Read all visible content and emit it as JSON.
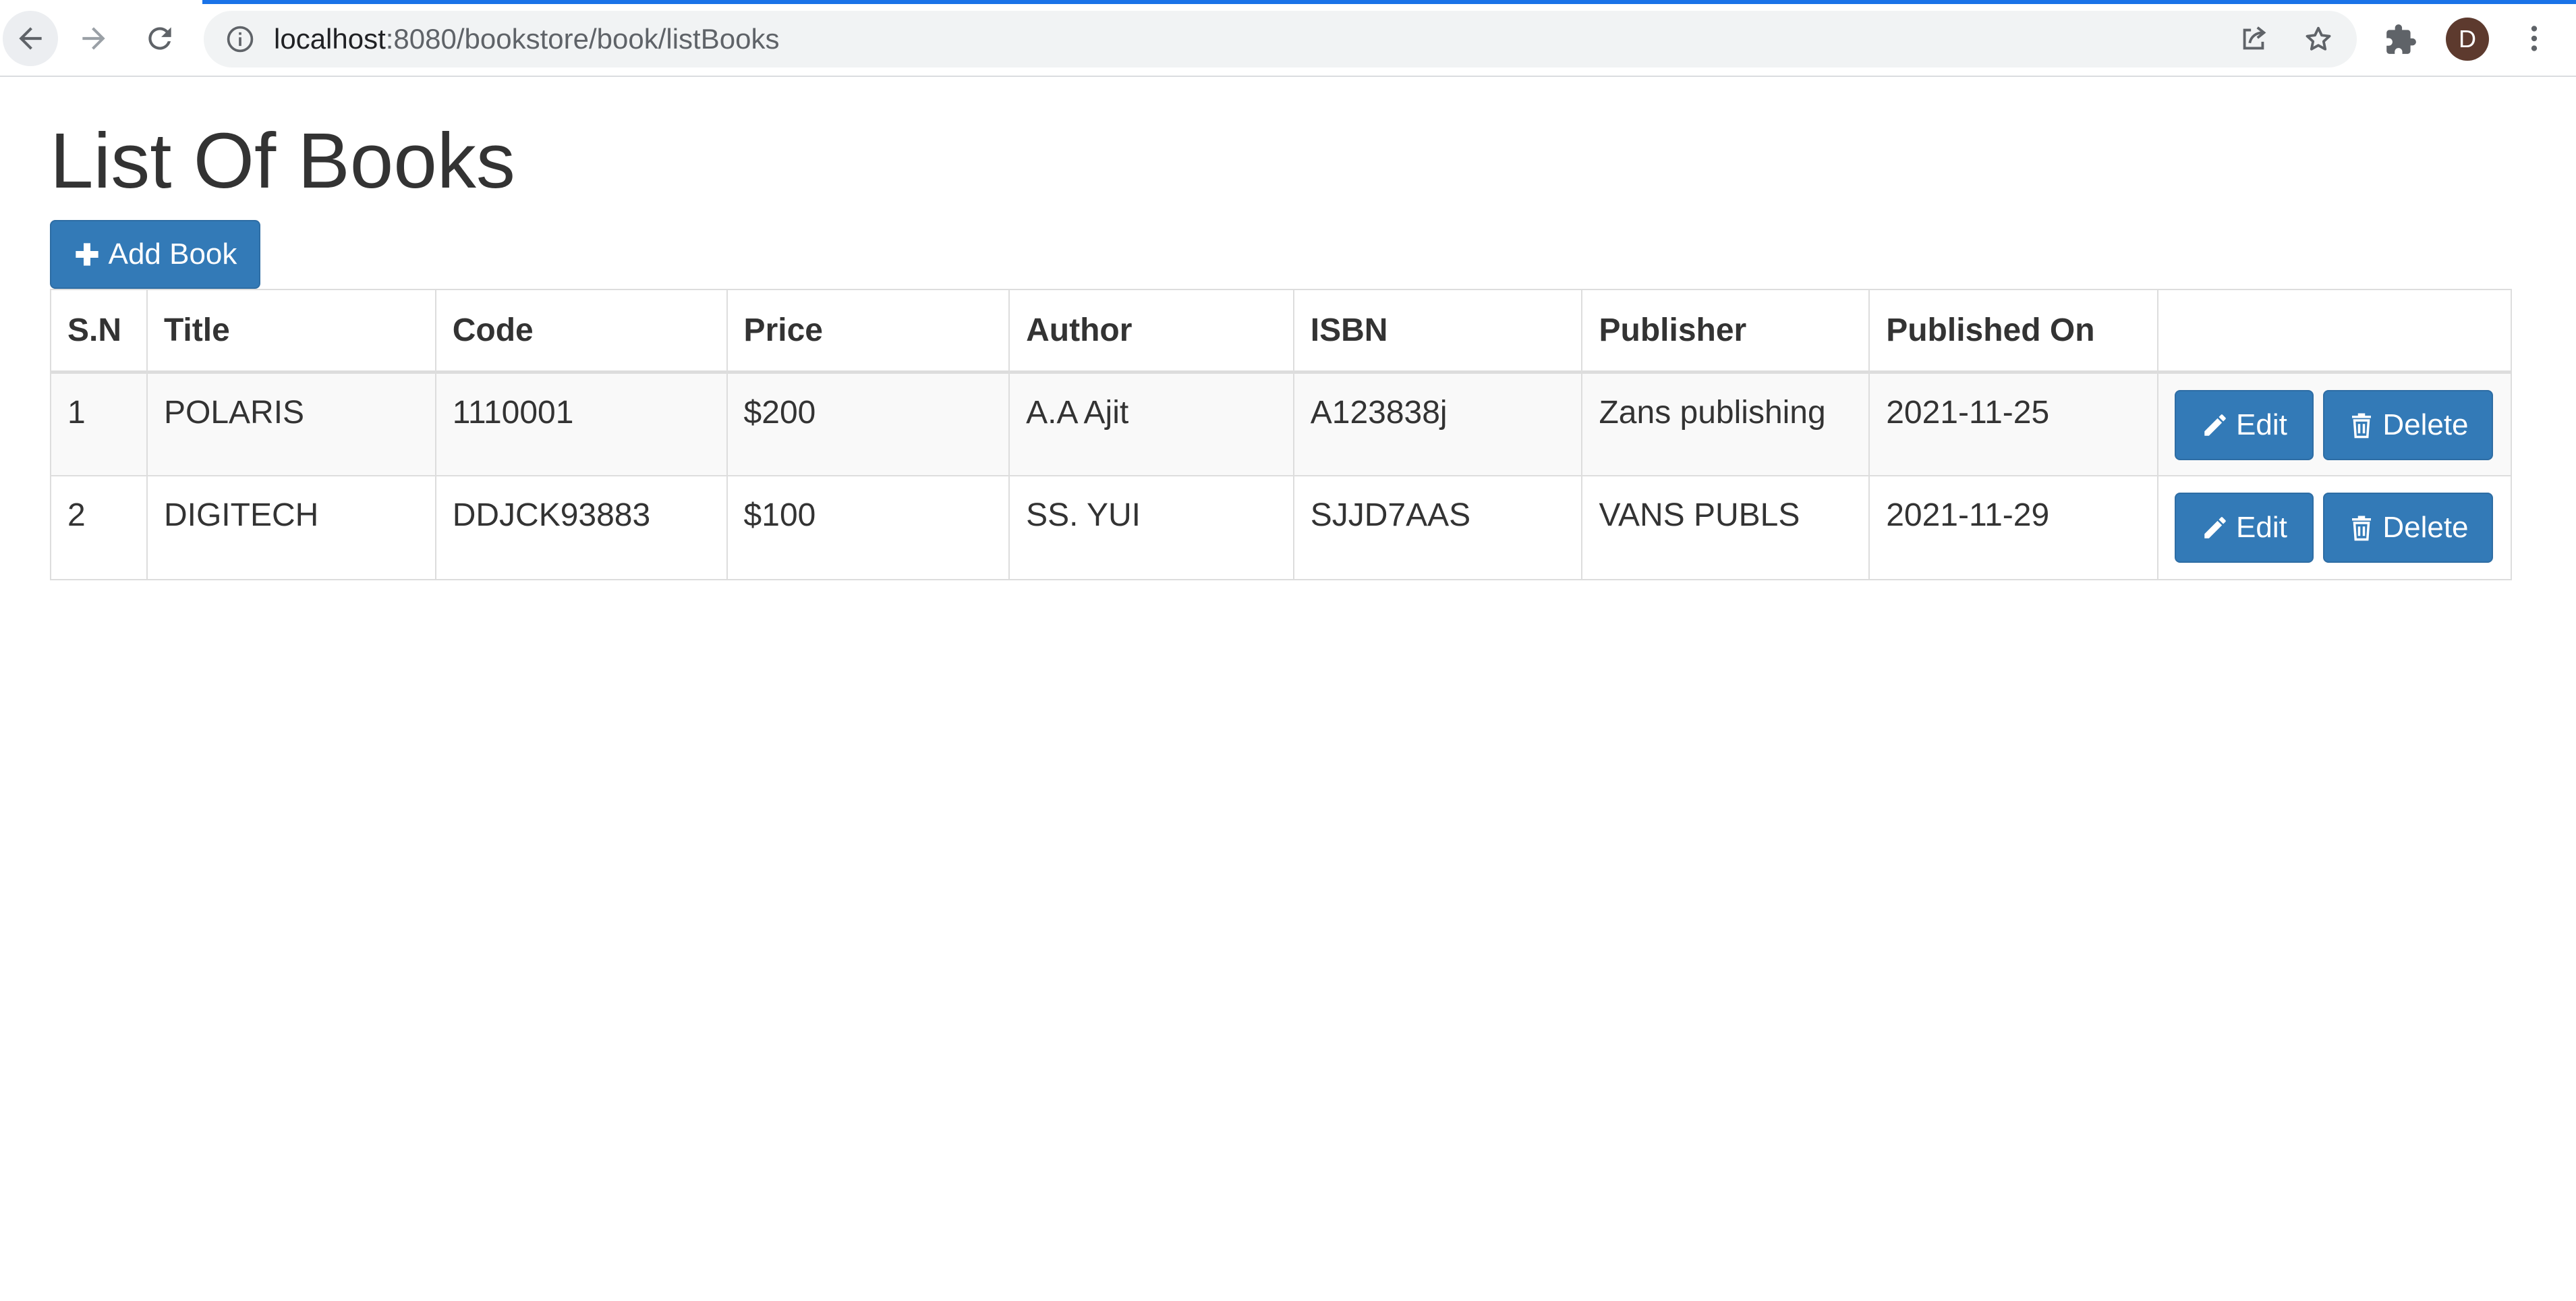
{
  "browser": {
    "url_host": "localhost",
    "url_path": ":8080/bookstore/book/listBooks",
    "profile_initial": "D",
    "accent_color": "#1a73e8"
  },
  "page": {
    "title": "List Of Books",
    "add_button_label": "Add Book",
    "primary_color": "#337ab7"
  },
  "table": {
    "headers": [
      "S.N",
      "Title",
      "Code",
      "Price",
      "Author",
      "ISBN",
      "Publisher",
      "Published On",
      ""
    ],
    "rows": [
      {
        "sn": "1",
        "title": "POLARIS",
        "code": "1110001",
        "price": "$200",
        "author": "A.A Ajit",
        "isbn": "A123838j",
        "publisher": "Zans publishing",
        "published_on": "2021-11-25",
        "edit_label": "Edit",
        "delete_label": "Delete"
      },
      {
        "sn": "2",
        "title": "DIGITECH",
        "code": "DDJCK93883",
        "price": "$100",
        "author": "SS. YUI",
        "isbn": "SJJD7AAS",
        "publisher": "VANS PUBLS",
        "published_on": "2021-11-29",
        "edit_label": "Edit",
        "delete_label": "Delete"
      }
    ]
  },
  "icons": {
    "back": "arrow-left-icon",
    "forward": "arrow-right-icon",
    "reload": "reload-icon",
    "info": "info-icon",
    "share": "share-icon",
    "bookmark": "star-icon",
    "extensions": "puzzle-icon",
    "menu": "kebab-menu-icon",
    "add": "plus-icon",
    "edit": "pencil-icon",
    "delete": "trash-icon"
  }
}
